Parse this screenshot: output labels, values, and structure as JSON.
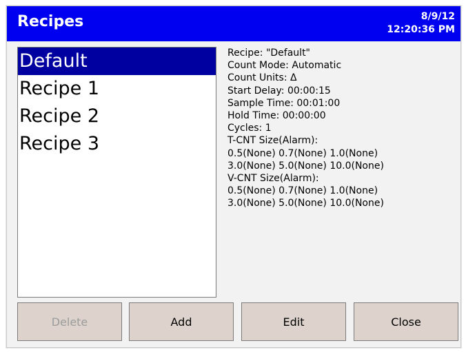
{
  "header": {
    "title": "Recipes",
    "date": "8/9/12",
    "time": "12:20:36 PM"
  },
  "recipes": {
    "items": [
      {
        "label": "Default",
        "selected": true
      },
      {
        "label": "Recipe 1",
        "selected": false
      },
      {
        "label": "Recipe 2",
        "selected": false
      },
      {
        "label": "Recipe 3",
        "selected": false
      }
    ]
  },
  "details": {
    "lines": [
      "Recipe: \"Default\"",
      "Count Mode: Automatic",
      "Count Units: Δ",
      "Start Delay: 00:00:15",
      "Sample Time: 00:01:00",
      "Hold Time: 00:00:00",
      "Cycles: 1",
      "T-CNT Size(Alarm):",
      "0.5(None) 0.7(None) 1.0(None)",
      "3.0(None) 5.0(None) 10.0(None)",
      "V-CNT Size(Alarm):",
      "0.5(None) 0.7(None) 1.0(None)",
      "3.0(None) 5.0(None) 10.0(None)"
    ]
  },
  "buttons": {
    "delete": "Delete",
    "add": "Add",
    "edit": "Edit",
    "close": "Close"
  },
  "colors": {
    "titlebar": "#0000f0",
    "selection": "#0000a0",
    "button_face": "#ddd3cc",
    "disabled_text": "#9b9b9b"
  }
}
